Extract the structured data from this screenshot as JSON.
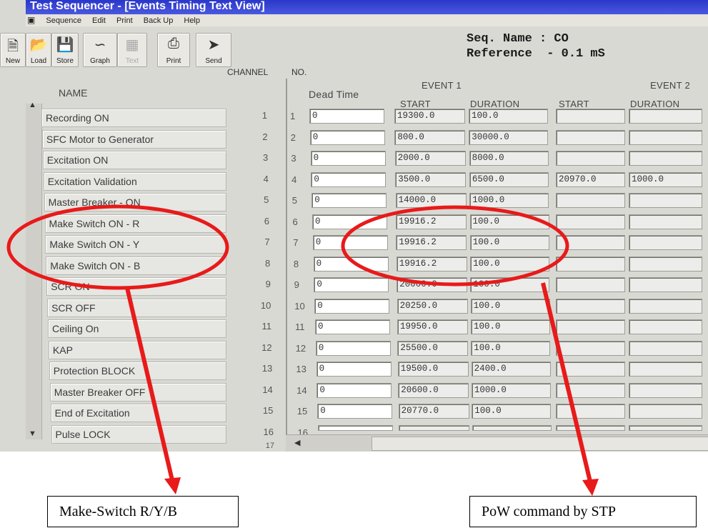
{
  "window": {
    "title": "Test Sequencer - [Events Timing Text View]"
  },
  "menu": [
    "Sequence",
    "Edit",
    "Print",
    "Back Up",
    "Help"
  ],
  "toolbar": [
    {
      "label": "New",
      "icon": "new-file-icon",
      "disabled": false
    },
    {
      "label": "Load",
      "icon": "folder-open-icon",
      "disabled": false
    },
    {
      "label": "Store",
      "icon": "floppy-disk-icon",
      "disabled": false
    },
    {
      "label": "Graph",
      "icon": "graph-icon",
      "disabled": false
    },
    {
      "label": "Text",
      "icon": "text-view-icon",
      "disabled": true
    },
    {
      "label": "Print",
      "icon": "printer-icon",
      "disabled": false
    },
    {
      "label": "Send",
      "icon": "send-icon",
      "disabled": false
    }
  ],
  "seq_info": {
    "name_line": "Seq. Name : CO",
    "reference_line": "Reference  - 0.1 mS"
  },
  "headers": {
    "channel": "CHANNEL",
    "no": "NO.",
    "name": "NAME",
    "dead_time": "Dead Time",
    "event1": "EVENT 1",
    "event2": "EVENT 2",
    "start": "START",
    "duration": "DURATION"
  },
  "rows": [
    {
      "ch": "1",
      "name": "Recording  ON",
      "dead": "0",
      "e1_start": "19300.0",
      "e1_dur": "100.0",
      "e2_start": "",
      "e2_dur": ""
    },
    {
      "ch": "2",
      "name": "SFC Motor to Generator",
      "dead": "0",
      "e1_start": "800.0",
      "e1_dur": "30000.0",
      "e2_start": "",
      "e2_dur": ""
    },
    {
      "ch": "3",
      "name": "Excitation ON",
      "dead": "0",
      "e1_start": "2000.0",
      "e1_dur": "8000.0",
      "e2_start": "",
      "e2_dur": ""
    },
    {
      "ch": "4",
      "name": "Excitation Validation",
      "dead": "0",
      "e1_start": "3500.0",
      "e1_dur": "6500.0",
      "e2_start": "20970.0",
      "e2_dur": "1000.0"
    },
    {
      "ch": "5",
      "name": "Master Breaker - ON",
      "dead": "0",
      "e1_start": "14000.0",
      "e1_dur": "1000.0",
      "e2_start": "",
      "e2_dur": ""
    },
    {
      "ch": "6",
      "name": "Make Switch ON - R",
      "dead": "0",
      "e1_start": "19916.2",
      "e1_dur": "100.0",
      "e2_start": "",
      "e2_dur": ""
    },
    {
      "ch": "7",
      "name": "Make Switch ON - Y",
      "dead": "0",
      "e1_start": "19916.2",
      "e1_dur": "100.0",
      "e2_start": "",
      "e2_dur": ""
    },
    {
      "ch": "8",
      "name": "Make Switch ON - B",
      "dead": "0",
      "e1_start": "19916.2",
      "e1_dur": "100.0",
      "e2_start": "",
      "e2_dur": ""
    },
    {
      "ch": "9",
      "name": "SCR ON",
      "dead": "0",
      "e1_start": "20000.0",
      "e1_dur": "100.0",
      "e2_start": "",
      "e2_dur": ""
    },
    {
      "ch": "10",
      "name": "SCR OFF",
      "dead": "0",
      "e1_start": "20250.0",
      "e1_dur": "100.0",
      "e2_start": "",
      "e2_dur": ""
    },
    {
      "ch": "11",
      "name": "Ceiling On",
      "dead": "0",
      "e1_start": "19950.0",
      "e1_dur": "100.0",
      "e2_start": "",
      "e2_dur": ""
    },
    {
      "ch": "12",
      "name": "KAP",
      "dead": "0",
      "e1_start": "25500.0",
      "e1_dur": "100.0",
      "e2_start": "",
      "e2_dur": ""
    },
    {
      "ch": "13",
      "name": "Protection BLOCK",
      "dead": "0",
      "e1_start": "19500.0",
      "e1_dur": "2400.0",
      "e2_start": "",
      "e2_dur": ""
    },
    {
      "ch": "14",
      "name": "Master Breaker OFF",
      "dead": "0",
      "e1_start": "20600.0",
      "e1_dur": "1000.0",
      "e2_start": "",
      "e2_dur": ""
    },
    {
      "ch": "15",
      "name": "End of Excitation",
      "dead": "0",
      "e1_start": "20770.0",
      "e1_dur": "100.0",
      "e2_start": "",
      "e2_dur": ""
    },
    {
      "ch": "16",
      "name": "Pulse LOCK",
      "dead": "",
      "e1_start": "",
      "e1_dur": "",
      "e2_start": "",
      "e2_dur": ""
    }
  ],
  "row_next": "17",
  "callouts": {
    "left": "Make-Switch R/Y/B",
    "right": "PoW command by STP"
  },
  "colors": {
    "annotation": "#e81a1a",
    "titlebar": "#2a37c9"
  }
}
